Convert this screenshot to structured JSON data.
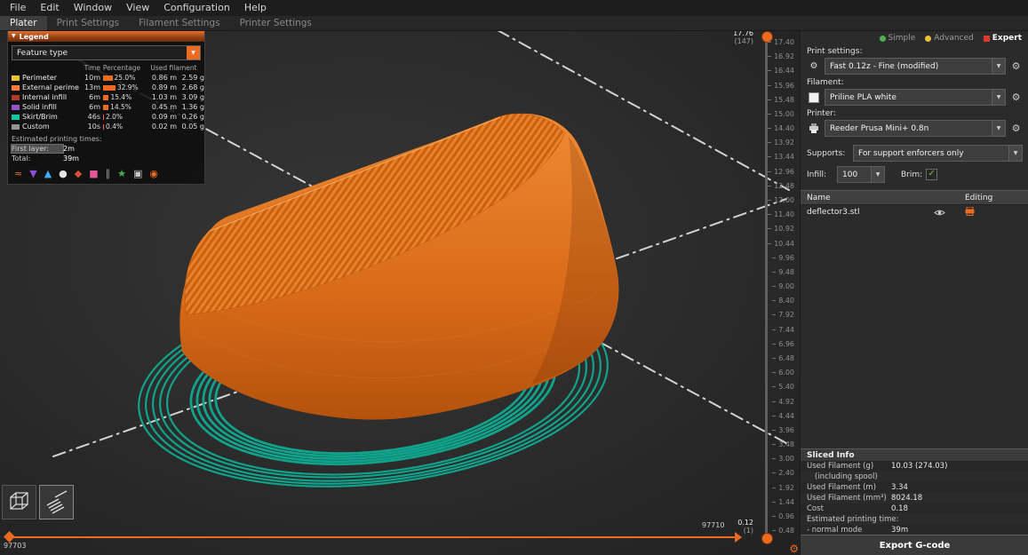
{
  "colors": {
    "accent": "#ED6B21",
    "skirt": "#10A38C",
    "model": "#E0751F"
  },
  "icons": {
    "chevron_down": "▼",
    "gear": "⚙",
    "check": "✓",
    "legend_caret": "▼"
  },
  "menu": {
    "items": [
      "File",
      "Edit",
      "Window",
      "View",
      "Configuration",
      "Help"
    ]
  },
  "tabs": [
    {
      "label": "Plater",
      "active": true
    },
    {
      "label": "Print Settings",
      "active": false
    },
    {
      "label": "Filament Settings",
      "active": false
    },
    {
      "label": "Printer Settings",
      "active": false
    }
  ],
  "legend": {
    "title": "Legend",
    "view_type": "Feature type",
    "columns": [
      "Time",
      "Percentage",
      "Used filament"
    ],
    "rows": [
      {
        "name": "Perimeter",
        "color": "#E8C32C",
        "time": "10m",
        "pct": "25.0%",
        "pct_val": 25.0,
        "m": "0.86 m",
        "g": "2.59 g"
      },
      {
        "name": "External perimeter",
        "color": "#FF7D38",
        "time": "13m",
        "pct": "32.9%",
        "pct_val": 32.9,
        "m": "0.89 m",
        "g": "2.68 g"
      },
      {
        "name": "Internal infill",
        "color": "#B03A29",
        "time": "6m",
        "pct": "15.4%",
        "pct_val": 15.4,
        "m": "1.03 m",
        "g": "3.09 g"
      },
      {
        "name": "Solid infill",
        "color": "#9654CC",
        "time": "6m",
        "pct": "14.5%",
        "pct_val": 14.5,
        "m": "0.45 m",
        "g": "1.36 g"
      },
      {
        "name": "Skirt/Brim",
        "color": "#00C8A0",
        "time": "46s",
        "pct": "2.0%",
        "pct_val": 2.0,
        "m": "0.09 m",
        "g": "0.26 g"
      },
      {
        "name": "Custom",
        "color": "#94948C",
        "time": "10s",
        "pct": "0.4%",
        "pct_val": 0.4,
        "m": "0.02 m",
        "g": "0.05 g"
      }
    ],
    "times_title": "Estimated printing times:",
    "first_layer_label": "First layer:",
    "first_layer_value": "2m",
    "total_label": "Total:",
    "total_value": "39m",
    "icons": [
      {
        "name": "travel-icon",
        "glyph": "≈",
        "color": "#E2703A"
      },
      {
        "name": "retractions-icon",
        "glyph": "▼",
        "color": "#8B4FD8"
      },
      {
        "name": "deretractions-icon",
        "glyph": "▲",
        "color": "#3FA9F5"
      },
      {
        "name": "seams-icon",
        "glyph": "●",
        "color": "#E6E6E6"
      },
      {
        "name": "tool-changes-icon",
        "glyph": "◆",
        "color": "#D94F3C"
      },
      {
        "name": "color-changes-icon",
        "glyph": "■",
        "color": "#E0599A"
      },
      {
        "name": "pause-prints-icon",
        "glyph": "∥",
        "color": "#9AA0A6"
      },
      {
        "name": "custom-gcode-icon",
        "glyph": "★",
        "color": "#49B34A"
      },
      {
        "name": "shells-icon",
        "glyph": "▣",
        "color": "#C9C9C9"
      },
      {
        "name": "legend-toggle-icon",
        "glyph": "◉",
        "color": "#ED6B21"
      }
    ]
  },
  "layer_slider": {
    "top_value": "17.76",
    "top_count": "(147)",
    "bottom_value": "0.12",
    "bottom_count": "(1)",
    "ticks": [
      "17.40",
      "16.92",
      "16.44",
      "15.96",
      "15.48",
      "15.00",
      "14.40",
      "13.92",
      "13.44",
      "12.96",
      "12.48",
      "12.00",
      "11.40",
      "10.92",
      "10.44",
      "9.96",
      "9.48",
      "9.00",
      "8.40",
      "7.92",
      "7.44",
      "6.96",
      "6.48",
      "6.00",
      "5.40",
      "4.92",
      "4.44",
      "3.96",
      "3.48",
      "3.00",
      "2.40",
      "1.92",
      "1.44",
      "0.96",
      "0.48"
    ]
  },
  "hslider": {
    "left_value": "97703",
    "right_value": "97710"
  },
  "right_panel": {
    "modes": [
      {
        "label": "Simple",
        "color": "#4CAF50",
        "active": false
      },
      {
        "label": "Advanced",
        "color": "#E8C03A",
        "active": false
      },
      {
        "label": "Expert",
        "color": "#E03A2F",
        "active": true
      }
    ],
    "print_settings": {
      "label": "Print settings:",
      "value": "Fast 0.12z - Fine (modified)"
    },
    "filament": {
      "label": "Filament:",
      "value": "Priline PLA white"
    },
    "printer": {
      "label": "Printer:",
      "value": "Reeder Prusa Mini+ 0.8n"
    },
    "supports": {
      "label": "Supports:",
      "value": "For support enforcers only"
    },
    "infill": {
      "label": "Infill:",
      "value": "100"
    },
    "brim": {
      "label": "Brim:",
      "checked": true,
      "check": "✓"
    },
    "object_table": {
      "columns": [
        "Name",
        "Editing"
      ],
      "rows": [
        {
          "name": "deflector3.stl"
        }
      ]
    },
    "sliced_info": {
      "title": "Sliced Info",
      "rows": [
        {
          "label": "Used Filament (g)",
          "value": "10.03 (274.03)"
        },
        {
          "label": "(including spool)",
          "value": "",
          "indent": true
        },
        {
          "label": "Used Filament (m)",
          "value": "3.34"
        },
        {
          "label": "Used Filament (mm³)",
          "value": "8024.18"
        },
        {
          "label": "Cost",
          "value": "0.18"
        },
        {
          "label": "Estimated printing time:",
          "value": ""
        },
        {
          "label": "- normal mode",
          "value": "39m"
        }
      ]
    },
    "export_button": "Export G-code"
  }
}
